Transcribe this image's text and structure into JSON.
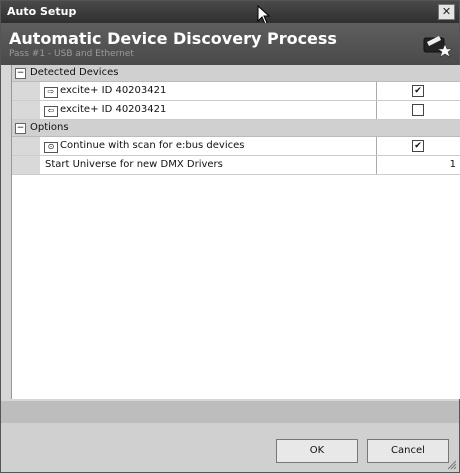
{
  "window": {
    "title": "Auto Setup",
    "close_glyph": "✕"
  },
  "header": {
    "title": "Automatic Device Discovery Process",
    "subtitle": "Pass #1 - USB and Ethernet",
    "logo_icon": "dmx-logo-icon"
  },
  "sections": [
    {
      "label": "Detected Devices",
      "toggle": "−",
      "rows": [
        {
          "label": "excite+ ID 40203421",
          "icon": "device-out-icon",
          "checked": true
        },
        {
          "label": "excite+ ID 40203421",
          "icon": "device-in-icon",
          "checked": false
        }
      ]
    },
    {
      "label": "Options",
      "toggle": "−",
      "rows": [
        {
          "label": "Continue with scan for e:bus devices",
          "icon": "scan-icon",
          "checked": true
        },
        {
          "label": "Start Universe for new DMX Drivers",
          "value": "1"
        }
      ]
    }
  ],
  "buttons": {
    "ok": "OK",
    "cancel": "Cancel"
  }
}
